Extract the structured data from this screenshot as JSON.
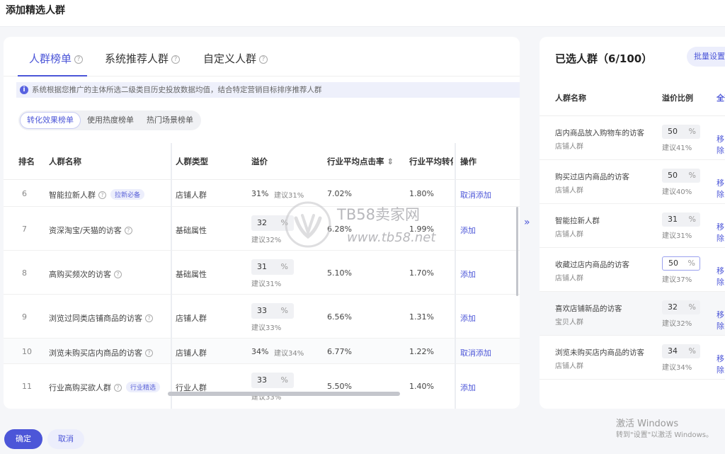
{
  "title": "添加精选人群",
  "tabs": [
    "人群榜单",
    "系统推荐人群",
    "自定义人群"
  ],
  "notice": "系统根据您推广的主体所选二级类目历史投放数据均值，结合特定营销目标排序推荐人群",
  "subtabs": [
    "转化效果榜单",
    "使用热度榜单",
    "热门场景榜单"
  ],
  "table": {
    "headers": [
      "排名",
      "人群名称",
      "人群类型",
      "溢价",
      "行业平均点击率",
      "行业平均转化",
      "操作"
    ],
    "rows": [
      {
        "rank": "6",
        "name": "智能拉新人群",
        "tag": "拉新必备",
        "type": "店铺人群",
        "premium": "31%",
        "suggest": "建议31%",
        "ctr": "7.02%",
        "cvr": "1.80%",
        "action": "取消添加"
      },
      {
        "rank": "7",
        "name": "资深淘宝/天猫的访客",
        "tag": "",
        "type": "基础属性",
        "premium": "32",
        "suggest": "建议32%",
        "ctr": "6.28%",
        "cvr": "1.99%",
        "action": "添加"
      },
      {
        "rank": "8",
        "name": "高购买频次的访客",
        "tag": "",
        "type": "基础属性",
        "premium": "31",
        "suggest": "建议31%",
        "ctr": "5.10%",
        "cvr": "1.70%",
        "action": "添加"
      },
      {
        "rank": "9",
        "name": "浏览过同类店铺商品的访客",
        "tag": "",
        "type": "店铺人群",
        "premium": "33",
        "suggest": "建议33%",
        "ctr": "6.56%",
        "cvr": "1.31%",
        "action": "添加"
      },
      {
        "rank": "10",
        "name": "浏览未购买店内商品的访客",
        "tag": "",
        "type": "店铺人群",
        "premium": "34%",
        "suggest": "建议34%",
        "ctr": "6.77%",
        "cvr": "1.22%",
        "action": "取消添加"
      },
      {
        "rank": "11",
        "name": "行业高购买欲人群",
        "tag": "行业精选",
        "type": "行业人群",
        "premium": "33",
        "suggest": "建议33%",
        "ctr": "5.50%",
        "cvr": "1.40%",
        "action": "添加"
      }
    ]
  },
  "selected": {
    "title": "已选人群（6/100）",
    "batch_label": "批量设置",
    "headers": [
      "人群名称",
      "溢价比例",
      "全部"
    ],
    "pct_unit": "%",
    "rows": [
      {
        "name": "店内商品放入购物车的访客",
        "type": "店铺人群",
        "value": "50",
        "suggest": "建议41%",
        "action": "移除"
      },
      {
        "name": "购买过店内商品的访客",
        "type": "店铺人群",
        "value": "50",
        "suggest": "建议40%",
        "action": "移除"
      },
      {
        "name": "智能拉新人群",
        "type": "店铺人群",
        "value": "31",
        "suggest": "建议31%",
        "action": "移除"
      },
      {
        "name": "收藏过店内商品的访客",
        "type": "店铺人群",
        "value": "50",
        "suggest": "建议37%",
        "action": "移除"
      },
      {
        "name": "喜欢店铺新品的访客",
        "type": "宝贝人群",
        "value": "32",
        "suggest": "建议32%",
        "action": "移除"
      },
      {
        "name": "浏览未购买店内商品的访客",
        "type": "店铺人群",
        "value": "34",
        "suggest": "建议34%",
        "action": "移除"
      }
    ]
  },
  "footer": {
    "ok": "确定",
    "cancel": "取消"
  },
  "watermark": {
    "brand": "TB58卖家网",
    "url": "www.tb58.net"
  },
  "windows": {
    "line1": "激活 Windows",
    "line2": "转到\"设置\"以激活 Windows。"
  }
}
